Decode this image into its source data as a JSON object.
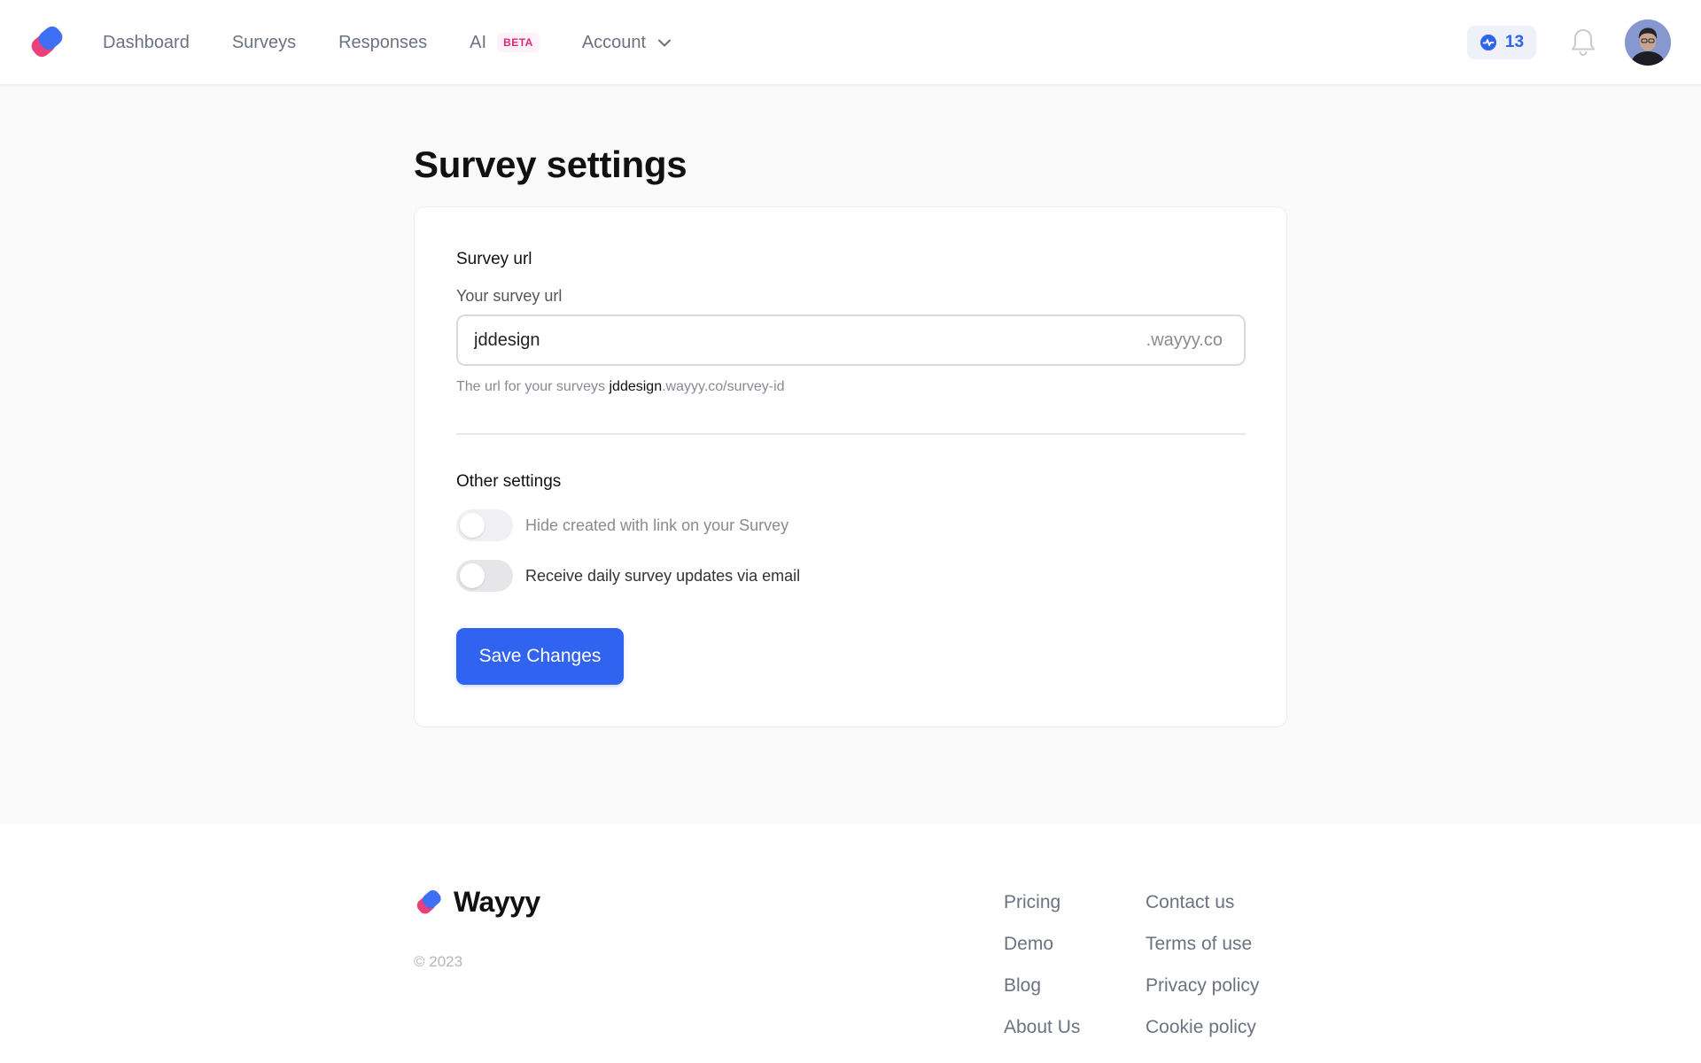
{
  "nav": {
    "links": [
      {
        "label": "Dashboard"
      },
      {
        "label": "Surveys"
      },
      {
        "label": "Responses"
      },
      {
        "label": "AI",
        "badge": "BETA"
      },
      {
        "label": "Account",
        "icon": "chevron-down-icon"
      }
    ],
    "stat_count": "13",
    "stat_icon": "activity-badge-icon",
    "notifications_icon": "bell-icon",
    "avatar_icon": "user-avatar"
  },
  "page": {
    "title": "Survey settings"
  },
  "survey_url": {
    "section_title": "Survey url",
    "field_label": "Your survey url",
    "value": "jddesign",
    "suffix": ".wayyy.co",
    "help_prefix": "The url for your surveys ",
    "help_subdomain": "jddesign",
    "help_suffix": ".wayyy.co/survey-id"
  },
  "other_settings": {
    "section_title": "Other settings",
    "toggles": [
      {
        "label": "Hide created with link on your Survey",
        "on": false,
        "disabled": true
      },
      {
        "label": "Receive daily survey updates via email",
        "on": false,
        "disabled": false
      }
    ]
  },
  "actions": {
    "save_label": "Save Changes"
  },
  "footer": {
    "brand": "Wayyy",
    "copyright": "© 2023",
    "col1": [
      "Pricing",
      "Demo",
      "Blog",
      "About Us"
    ],
    "col2": [
      "Contact us",
      "Terms of use",
      "Privacy policy",
      "Cookie policy"
    ]
  },
  "colors": {
    "accent": "#2f63f0",
    "brand_pink": "#e9407a",
    "brand_blue": "#3f6ff5",
    "beta": "#db2777"
  }
}
